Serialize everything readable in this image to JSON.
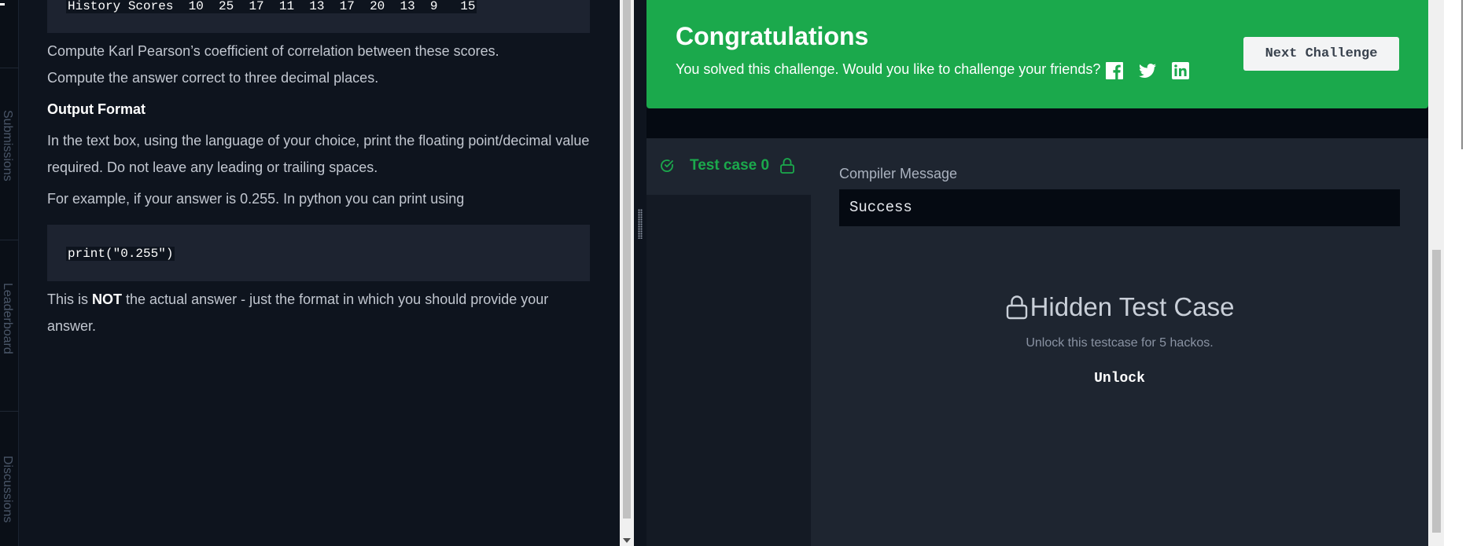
{
  "rail": {
    "tabs": [
      "Submissions",
      "Leaderboard",
      "Discussions"
    ]
  },
  "problem": {
    "code_line_1": "History Scores  10  25  17  11  13  17  20  13  9   15",
    "para_1": "Compute Karl Pearson’s coefficient of correlation between these scores.",
    "para_2": "Compute the answer correct to three decimal places.",
    "output_heading": "Output Format",
    "para_3": "In the text box, using the language of your choice, print the floating point/decimal value required. Do not leave any leading or trailing spaces.",
    "para_4": "For example, if your answer is 0.255. In python you can print using",
    "code_example": "print(\"0.255\")",
    "para_5_pre": "This is ",
    "para_5_bold": "NOT",
    "para_5_post": " the actual answer - just the format in which you should provide your answer."
  },
  "congrats": {
    "title": "Congratulations",
    "subtitle": "You solved this challenge. Would you like to challenge your friends?",
    "share_icons": [
      "facebook-icon",
      "twitter-icon",
      "linkedin-icon"
    ],
    "next_label": "Next Challenge",
    "accent": "#1ba94c"
  },
  "results": {
    "testcase_label": "Test case 0",
    "compiler_label": "Compiler Message",
    "compiler_value": "Success",
    "hidden_title": "Hidden Test Case",
    "hidden_sub": "Unlock this testcase for 5 hackos.",
    "unlock_label": "Unlock"
  }
}
